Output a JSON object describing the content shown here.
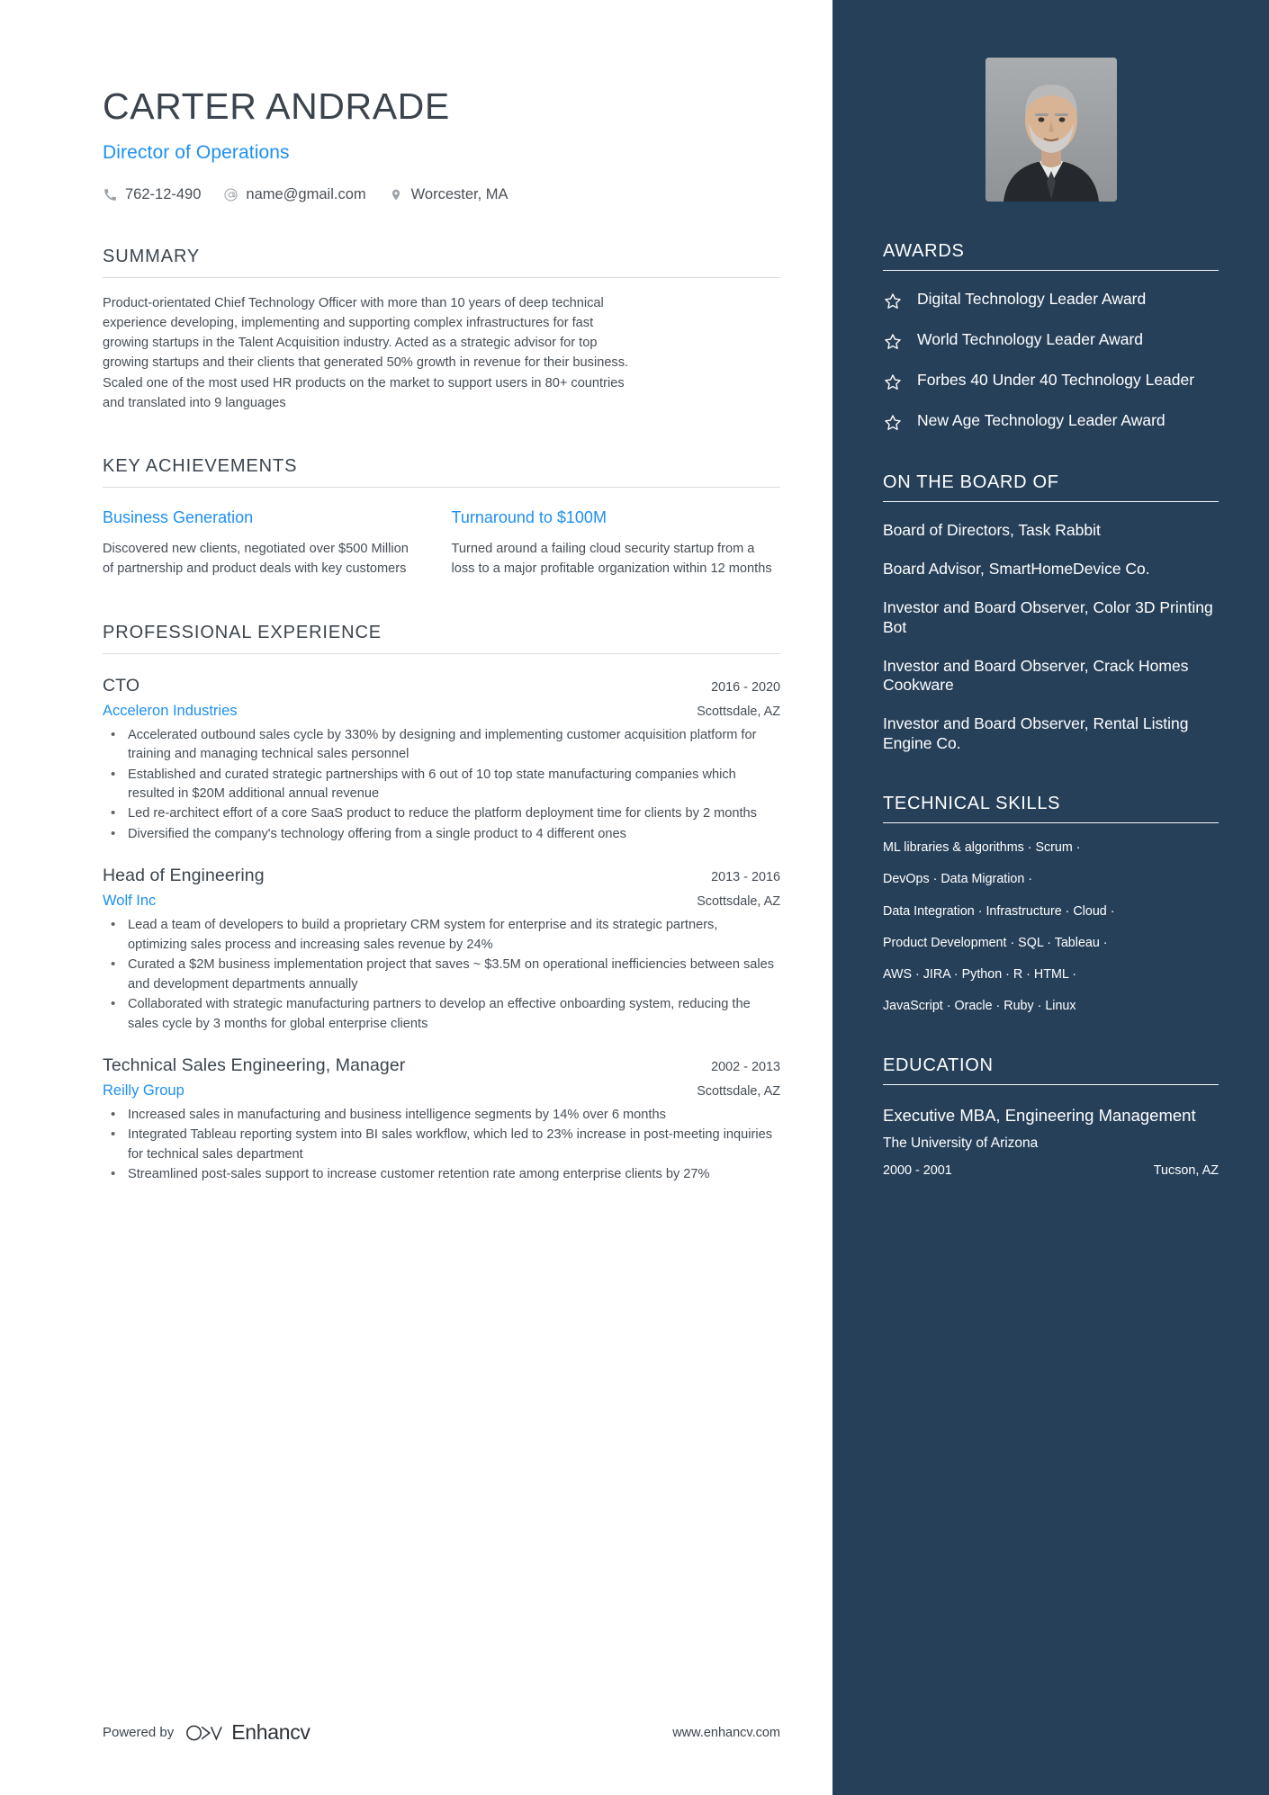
{
  "header": {
    "name": "CARTER ANDRADE",
    "role": "Director of Operations",
    "contacts": [
      {
        "icon": "phone-icon",
        "value": "762-12-490"
      },
      {
        "icon": "email-icon",
        "value": "name@gmail.com"
      },
      {
        "icon": "location-pin-icon",
        "value": "Worcester, MA"
      }
    ]
  },
  "summary": {
    "title": "SUMMARY",
    "text": "Product-orientated Chief Technology Officer with more than 10 years of deep technical experience developing, implementing and supporting complex infrastructures for fast growing startups in the Talent Acquisition industry. Acted as a strategic advisor for top growing startups and their clients that generated 50% growth in revenue for their business. Scaled one of the most used HR products on the market to support users in 80+ countries and translated into 9 languages"
  },
  "key_achievements": {
    "title": "KEY ACHIEVEMENTS",
    "items": [
      {
        "title": "Business Generation",
        "text": "Discovered new clients, negotiated over $500 Million of partnership and product deals with key customers"
      },
      {
        "title": "Turnaround to $100M",
        "text": "Turned around a failing cloud security startup from a loss to a major profitable organization within 12 months"
      }
    ]
  },
  "experience": {
    "title": "PROFESSIONAL EXPERIENCE",
    "jobs": [
      {
        "title": "CTO",
        "dates": "2016 - 2020",
        "company": "Acceleron Industries",
        "location": "Scottsdale, AZ",
        "bullets": [
          "Accelerated outbound sales cycle by 330% by designing and implementing customer acquisition platform for training and managing technical sales personnel",
          "Established and curated strategic partnerships with 6 out of 10 top state manufacturing companies which resulted in $20M additional annual revenue",
          "Led re-architect effort of a core SaaS product to reduce the platform deployment time for clients by 2 months",
          "Diversified the company's technology offering from a single product to 4 different ones"
        ]
      },
      {
        "title": "Head of Engineering",
        "dates": "2013 - 2016",
        "company": "Wolf Inc",
        "location": "Scottsdale, AZ",
        "bullets": [
          "Lead a team of developers to build a proprietary CRM system for enterprise and its strategic partners, optimizing sales process and increasing sales revenue by 24%",
          "Curated a $2M business implementation project that saves ~ $3.5M on operational inefficiencies between sales and development departments annually",
          "Collaborated with strategic manufacturing partners to develop an effective onboarding system, reducing the sales cycle by 3 months for global enterprise clients"
        ]
      },
      {
        "title": "Technical Sales Engineering, Manager",
        "dates": "2002 - 2013",
        "company": "Reilly Group",
        "location": "Scottsdale, AZ",
        "bullets": [
          "Increased sales in manufacturing and business intelligence segments by 14% over 6 months",
          "Integrated Tableau reporting system into BI sales workflow, which led to 23% increase in post-meeting inquiries for technical sales department",
          "Streamlined post-sales support to increase customer retention rate among enterprise clients by 27%"
        ]
      }
    ]
  },
  "footer": {
    "powered_by": "Powered by",
    "brand": "Enhancv",
    "website": "www.enhancv.com"
  },
  "sidebar": {
    "photo_alt": "profile-photo",
    "awards": {
      "title": "AWARDS",
      "items": [
        "Digital Technology Leader Award",
        "World Technology Leader Award",
        "Forbes 40 Under 40 Technology Leader",
        "New Age Technology Leader Award"
      ]
    },
    "board": {
      "title": "ON THE BOARD OF",
      "items": [
        "Board of Directors, Task Rabbit",
        "Board Advisor, SmartHomeDevice Co.",
        "Investor and Board Observer, Color 3D Printing Bot",
        "Investor and Board Observer, Crack Homes Cookware",
        "Investor and Board Observer, Rental Listing Engine Co."
      ]
    },
    "skills": {
      "title": "TECHNICAL SKILLS",
      "lines": [
        "ML libraries & algorithms · Scrum ·",
        "DevOps · Data Migration ·",
        "Data Integration · Infrastructure · Cloud ·",
        "Product Development · SQL · Tableau ·",
        "AWS · JIRA · Python ·   R   · HTML ·",
        "JavaScript · Oracle · Ruby · Linux"
      ]
    },
    "education": {
      "title": "EDUCATION",
      "degree": "Executive MBA, Engineering Management",
      "school": "The University of Arizona",
      "dates": "2000 - 2001",
      "location": "Tucson, AZ"
    }
  },
  "colors": {
    "accent_blue": "#1e90f0",
    "sidebar_bg": "#27405a",
    "text_dark": "#3b444d"
  }
}
